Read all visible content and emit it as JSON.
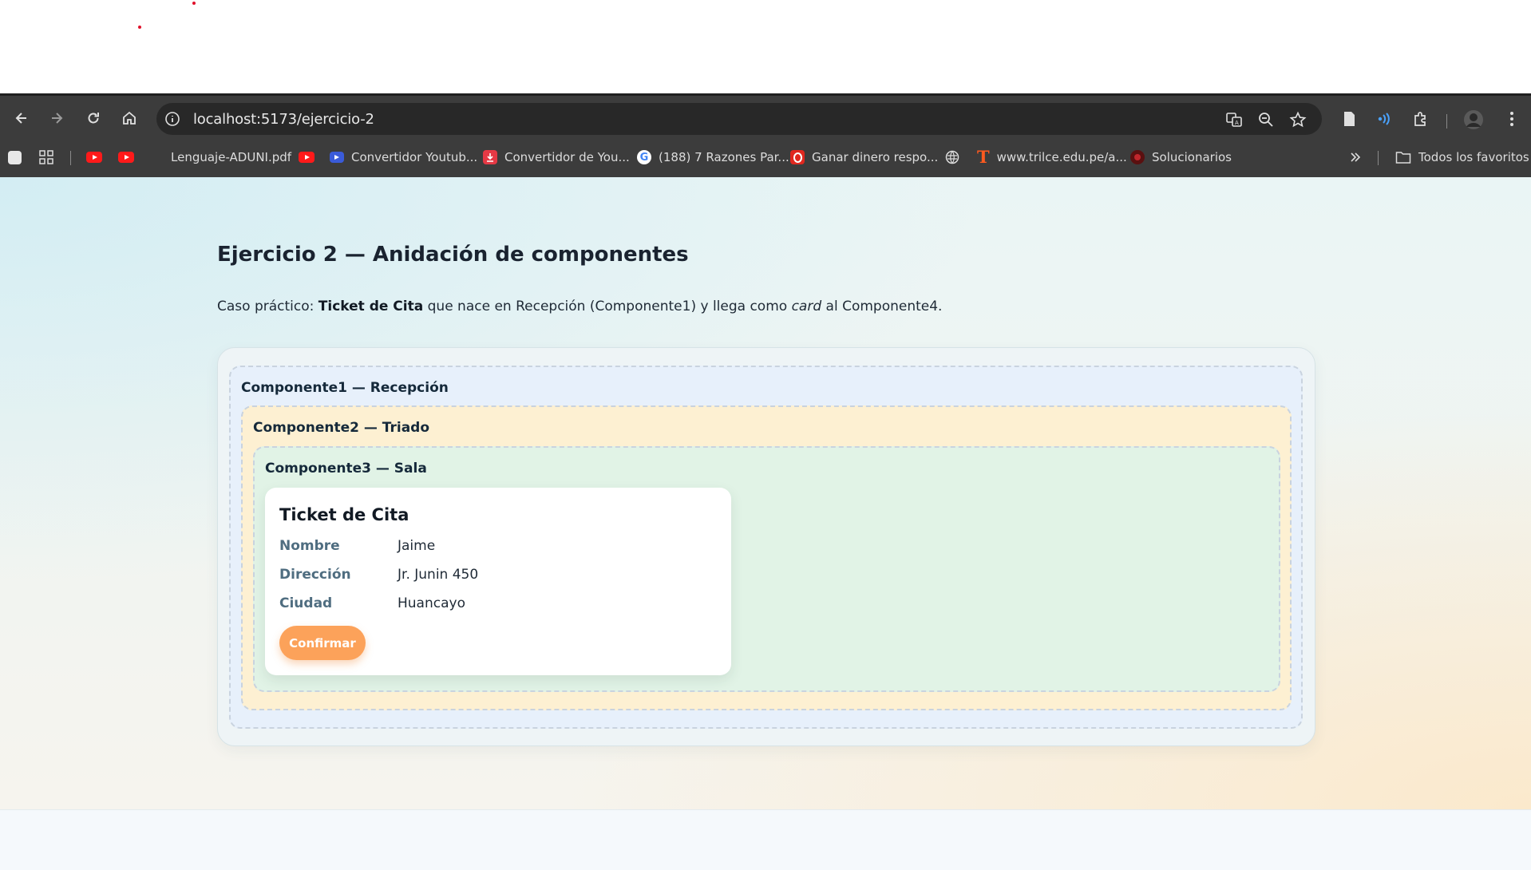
{
  "browser": {
    "url": "localhost:5173/ejercicio-2",
    "bookmarks": [
      {
        "label": "",
        "icon": "apps-grid-icon"
      },
      {
        "label": "",
        "icon": "youtube-icon"
      },
      {
        "label": "",
        "icon": "youtube-icon"
      },
      {
        "label": "Lenguaje-ADUNI.pdf",
        "icon": "none"
      },
      {
        "label": "",
        "icon": "youtube-icon"
      },
      {
        "label": "Convertidor Youtub...",
        "icon": "video-icon"
      },
      {
        "label": "Convertidor de You...",
        "icon": "download-icon"
      },
      {
        "label": "(188) 7 Razones Par...",
        "icon": "google-icon"
      },
      {
        "label": "Ganar dinero respo...",
        "icon": "opera-icon"
      },
      {
        "label": "",
        "icon": "globe-icon"
      },
      {
        "label": "www.trilce.edu.pe/a...",
        "icon": "trilce-t-icon"
      },
      {
        "label": "Solucionarios",
        "icon": "site-icon"
      }
    ],
    "all_bookmarks_label": "Todos los favoritos",
    "colors": {
      "chrome": "#3c3c3c",
      "omnibox": "#282828"
    }
  },
  "page": {
    "title": "Ejercicio 2 — Anidación de componentes",
    "subtitle": {
      "prefix": "Caso práctico: ",
      "bold": "Ticket de Cita",
      "middle": " que nace en Recepción (Componente1) y llega como ",
      "italic": "card",
      "suffix": " al Componente4."
    },
    "components": {
      "c1_label": "Componente1 — Recepción",
      "c2_label": "Componente2 — Triado",
      "c3_label": "Componente3 — Sala"
    },
    "ticket": {
      "title": "Ticket de Cita",
      "rows": [
        {
          "label": "Nombre",
          "value": "Jaime"
        },
        {
          "label": "Dirección",
          "value": "Jr. Junin 450"
        },
        {
          "label": "Ciudad",
          "value": "Huancayo"
        }
      ],
      "confirm_label": "Confirmar"
    },
    "colors": {
      "accent": "#fca25a",
      "comp1_bg": "#e7f0fb",
      "comp2_bg": "#fdf0d2",
      "comp3_bg": "#e1f3e6"
    }
  }
}
